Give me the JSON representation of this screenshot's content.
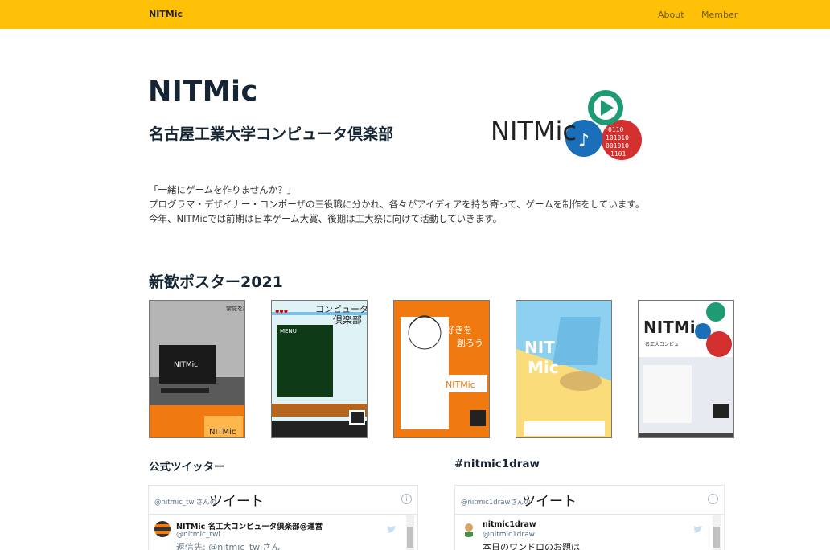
{
  "navbar": {
    "brand": "NITMic",
    "links": [
      {
        "label": "About"
      },
      {
        "label": "Member"
      }
    ],
    "color": "#ffc107"
  },
  "hero": {
    "title": "NITMic",
    "subtitle": "名古屋工業大学コンピュータ倶楽部",
    "logo_text": "NITMic"
  },
  "intro": {
    "lines": [
      "「一緒にゲームを作りませんか？」",
      "プログラマ・デザイナー・コンポーザの三役職に分かれ、各々がアイディアを持ち寄って、ゲームを制作をしています。",
      "今年、NITMicでは前期は日本ゲーム大賞、後期は工大祭に向けて活動していきます。"
    ]
  },
  "posters": {
    "title": "新歓ポスター2021",
    "items": [
      {
        "alt": "poster-1"
      },
      {
        "alt": "poster-2"
      },
      {
        "alt": "poster-3"
      },
      {
        "alt": "poster-4"
      },
      {
        "alt": "poster-5"
      }
    ]
  },
  "twitter": {
    "title": "公式ツイッター",
    "handle_label": "@nitmic_twiさんの",
    "header_big": "ツイート",
    "author_name": "NITMic 名工大コンピュータ倶楽部@運営",
    "author_handle": "@nitmic_twi",
    "preview": "返信先: @nitmic_twiさん"
  },
  "draw": {
    "title": "#nitmic1draw",
    "handle_label": "@nitmic1drawさんの",
    "header_big": "ツイート",
    "author_name": "nitmic1draw",
    "author_handle": "@nitmic1draw",
    "preview": "本日のワンドロのお題は"
  }
}
